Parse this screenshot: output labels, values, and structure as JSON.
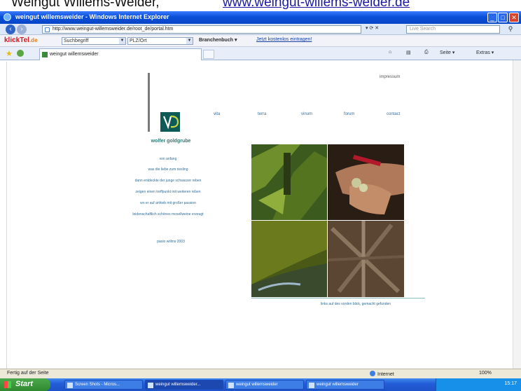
{
  "caption": {
    "lead": "Weingut Willems-Welder, ",
    "link": "www.weingut-willems-welder.de"
  },
  "window": {
    "title": "weingut willemsweider - Windows Internet Explorer",
    "min": "_",
    "max": "□",
    "close": "✕"
  },
  "address": {
    "url": "http://www.weingut-willemsweider.de/root_de/portal.htm",
    "search_placeholder": "Live Search",
    "search_icon": "magnifier-icon"
  },
  "toolbar": {
    "brand": "klickTel",
    "brand_suffix": ".de",
    "dropdown1": "Suchbegriff",
    "dropdown2": "PLZ/Ort",
    "branchenbuch": "Branchenbuch ▾",
    "link": "Jetzt kostenlos eintragen!"
  },
  "tabs": {
    "active_tab": "weingut willemsweider"
  },
  "commands": {
    "home": "⌂",
    "feeds": "▤",
    "print": "⎙",
    "page": "Seite ▾",
    "extras": "Extras ▾"
  },
  "page": {
    "impressum": "impressum",
    "nav": [
      "vita",
      "terra",
      "vinum",
      "forum",
      "contact"
    ],
    "brand_name": "wolfer goldgrube",
    "taglines": [
      "von anfang",
      "was die liebe zum riesling",
      "dann entdeckte der junge schwarzer reben",
      "zeigen einen treffpunkt mit weiteren reben",
      "wo er auf anhieb mit großer passion",
      "leidenschaftlich schönes mosellweine erzeugt"
    ],
    "signature": "paolo willms 2003",
    "photo_caption": "links auf des vorden blick, gemacht gefunden"
  },
  "status": {
    "message": "Fertig auf der Seite",
    "zone": "Internet",
    "zoom": "100%"
  },
  "taskbar": {
    "start": "Start",
    "tasks": [
      "Screen Shots - Micros...",
      "weingut willemsweider...",
      "weingut willemsweider",
      "weingut willemsweider"
    ],
    "clock": "15:17"
  },
  "colors": {
    "brand_teal": "#0d5a57",
    "link_blue": "#2f6e98",
    "xp_blue": "#245ed8",
    "start_green": "#2f8a2f"
  }
}
